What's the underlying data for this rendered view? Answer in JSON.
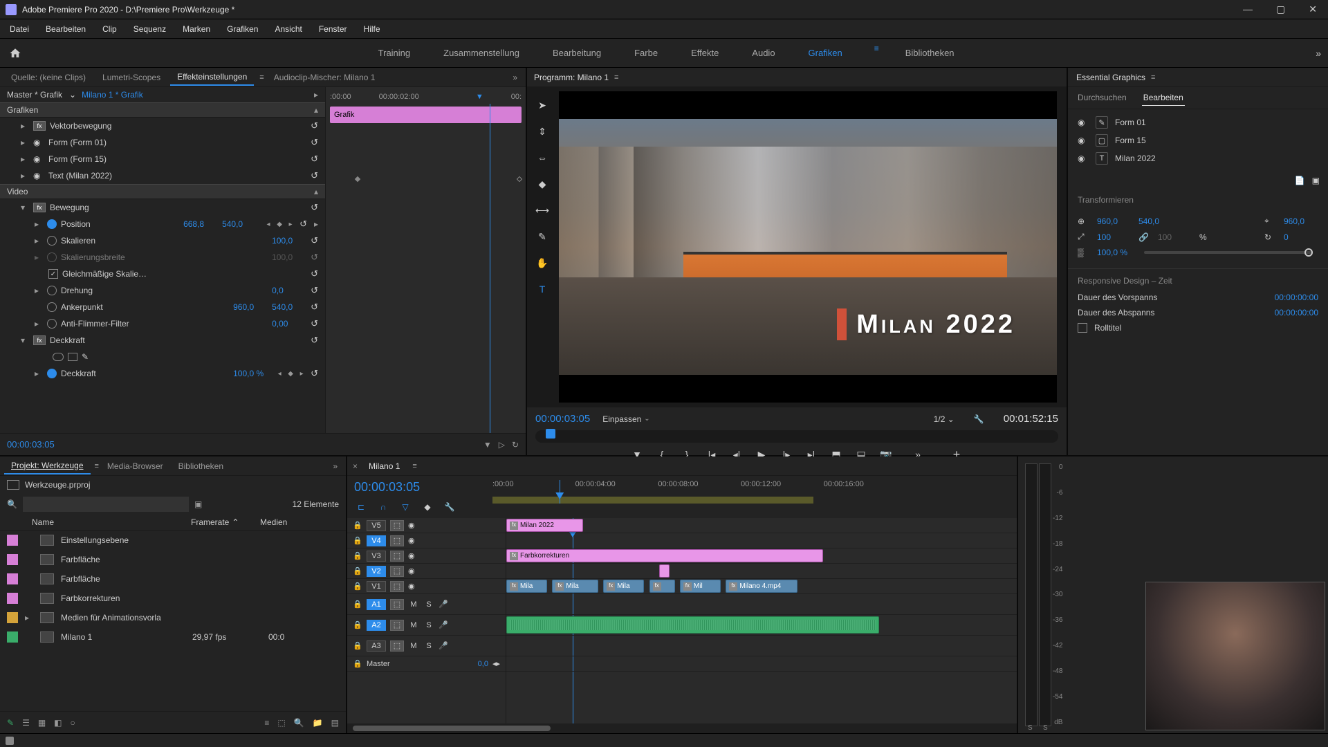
{
  "titlebar": {
    "app": "Adobe Premiere Pro 2020",
    "project_path": "D:\\Premiere Pro\\Werkzeuge *"
  },
  "menu": [
    "Datei",
    "Bearbeiten",
    "Clip",
    "Sequenz",
    "Marken",
    "Grafiken",
    "Ansicht",
    "Fenster",
    "Hilfe"
  ],
  "workspaces": {
    "items": [
      "Training",
      "Zusammenstellung",
      "Bearbeitung",
      "Farbe",
      "Effekte",
      "Audio",
      "Grafiken",
      "Bibliotheken"
    ],
    "active": "Grafiken"
  },
  "source_tabs": {
    "items": [
      "Quelle: (keine Clips)",
      "Lumetri-Scopes",
      "Effekteinstellungen",
      "Audioclip-Mischer: Milano 1"
    ],
    "active": "Effekteinstellungen"
  },
  "effect_controls": {
    "master": "Master * Grafik",
    "sequence": "Milano 1 * Grafik",
    "timeline_labels": [
      ":00:00",
      "00:00:02:00",
      "00:"
    ],
    "grafik_label": "Grafik",
    "sections": {
      "grafiken": "Grafiken",
      "video": "Video"
    },
    "items": {
      "vektorbewegung": "Vektorbewegung",
      "form01": "Form (Form 01)",
      "form15": "Form (Form 15)",
      "text_milan": "Text (Milan 2022)",
      "bewegung": "Bewegung",
      "position": "Position",
      "position_x": "668,8",
      "position_y": "540,0",
      "skalieren": "Skalieren",
      "skalieren_v": "100,0",
      "skalierungsbreite": "Skalierungsbreite",
      "skalierungsbreite_v": "100,0",
      "gleichmaessig": "Gleichmäßige Skalie…",
      "drehung": "Drehung",
      "drehung_v": "0,0",
      "ankerpunkt": "Ankerpunkt",
      "anker_x": "960,0",
      "anker_y": "540,0",
      "antiflimmer": "Anti-Flimmer-Filter",
      "antiflimmer_v": "0,00",
      "deckkraft": "Deckkraft",
      "deckkraft_inner": "Deckkraft",
      "deckkraft_v": "100,0 %"
    },
    "current_tc": "00:00:03:05"
  },
  "program": {
    "tab": "Programm: Milano 1",
    "title_text": "Milan 2022",
    "tc_current": "00:00:03:05",
    "zoom": "Einpassen",
    "resolution": "1/2",
    "tc_duration": "00:01:52:15"
  },
  "tools": [
    "selection",
    "track-select",
    "ripple",
    "razor",
    "slip",
    "pen",
    "hand",
    "type"
  ],
  "essential_graphics": {
    "title": "Essential Graphics",
    "tabs": [
      "Durchsuchen",
      "Bearbeiten"
    ],
    "active_tab": "Bearbeiten",
    "layers": [
      {
        "icon": "pen",
        "name": "Form 01"
      },
      {
        "icon": "shape",
        "name": "Form 15"
      },
      {
        "icon": "text",
        "name": "Milan 2022"
      }
    ],
    "transform": {
      "header": "Transformieren",
      "pos_x": "960,0",
      "pos_y": "540,0",
      "anchor_x": "960,0",
      "scale": "100",
      "scale_h": "100",
      "percent": "%",
      "rotation": "0",
      "opacity": "100,0 %"
    },
    "responsive": {
      "header": "Responsive Design – Zeit",
      "intro_label": "Dauer des Vorspanns",
      "intro_val": "00:00:00:00",
      "outro_label": "Dauer des Abspanns",
      "outro_val": "00:00:00:00",
      "roll_label": "Rolltitel"
    }
  },
  "project": {
    "tabs": [
      "Projekt: Werkzeuge",
      "Media-Browser",
      "Bibliotheken"
    ],
    "file": "Werkzeuge.prproj",
    "count": "12 Elemente",
    "headers": {
      "name": "Name",
      "framerate": "Framerate",
      "medien": "Medien"
    },
    "items": [
      {
        "color": "#d67fd6",
        "name": "Einstellungsebene",
        "fr": "",
        "med": ""
      },
      {
        "color": "#d67fd6",
        "name": "Farbfläche",
        "fr": "",
        "med": ""
      },
      {
        "color": "#d67fd6",
        "name": "Farbfläche",
        "fr": "",
        "med": ""
      },
      {
        "color": "#d67fd6",
        "name": "Farbkorrekturen",
        "fr": "",
        "med": ""
      },
      {
        "color": "#d4a33a",
        "name": "Medien für Animationsvorla",
        "fr": "",
        "med": "",
        "expandable": true
      },
      {
        "color": "#3aad6a",
        "name": "Milano 1",
        "fr": "29,97 fps",
        "med": "00:0"
      }
    ]
  },
  "timeline": {
    "tab": "Milano 1",
    "tc": "00:00:03:05",
    "ruler": [
      ":00:00",
      "00:00:04:00",
      "00:00:08:00",
      "00:00:12:00",
      "00:00:16:00"
    ],
    "video_tracks": [
      "V5",
      "V4",
      "V3",
      "V2",
      "V1"
    ],
    "audio_tracks": [
      "A1",
      "A2",
      "A3"
    ],
    "master": "Master",
    "master_val": "0,0",
    "clips": {
      "v5": "Milan 2022",
      "v3": "Farbkorrekturen",
      "v1": [
        "Mila",
        "Mila",
        "Mila",
        "",
        "Mil",
        "Milano 4.mp4"
      ]
    }
  },
  "meters": {
    "scale": [
      "0",
      "-6",
      "-12",
      "-18",
      "-24",
      "-30",
      "-36",
      "-42",
      "-48",
      "-54",
      "dB"
    ],
    "s": "S"
  }
}
